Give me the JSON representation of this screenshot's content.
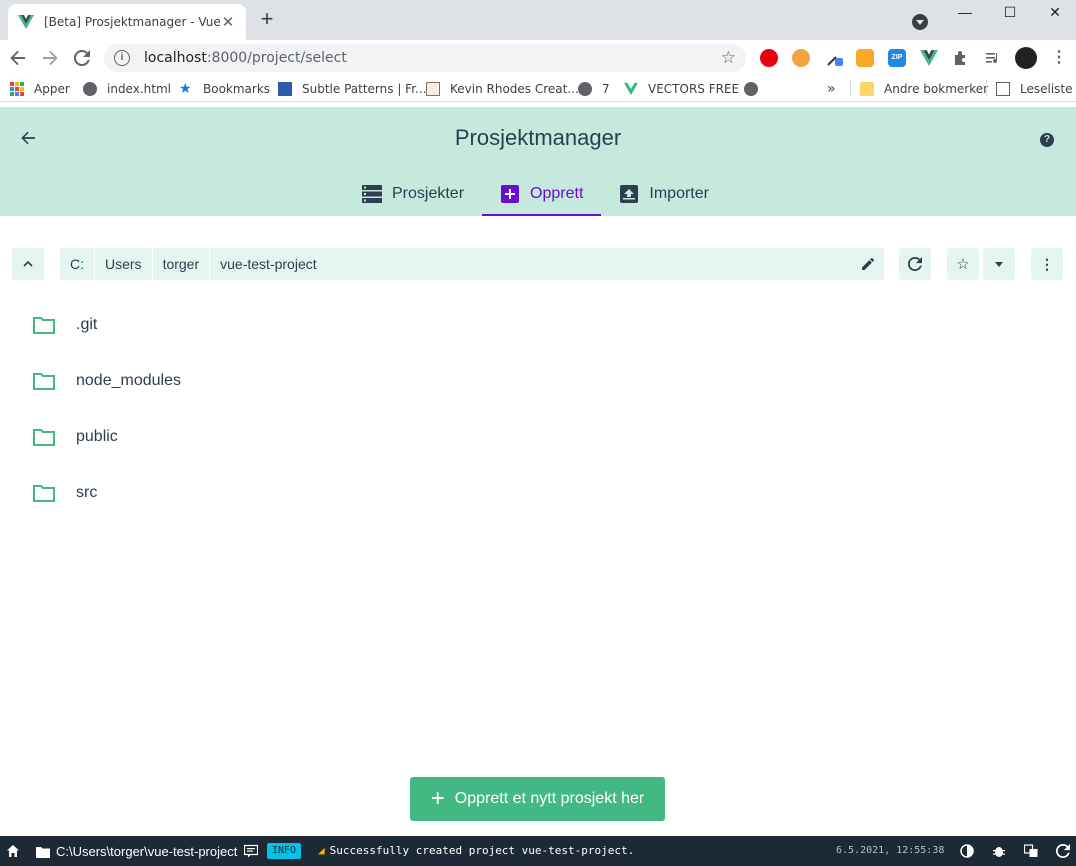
{
  "browser": {
    "tab_title": "[Beta] Prosjektmanager - Vue CLI",
    "tab_close": "✕",
    "new_tab": "+",
    "window_min": "—",
    "window_max": "☐",
    "window_close": "✕",
    "url_host": "localhost",
    "url_rest": ":8000/project/select",
    "bookmarks": [
      {
        "label": "Apper",
        "icon": "apps-grid-icon"
      },
      {
        "label": "index.html",
        "icon": "globe-icon"
      },
      {
        "label": "Bookmarks",
        "icon": "star-icon"
      },
      {
        "label": "Subtle Patterns | Fr...",
        "icon": "subtle-patterns-icon"
      },
      {
        "label": "Kevin Rhodes Creat...",
        "icon": "kr-logo-icon"
      },
      {
        "label": "7",
        "icon": "globe-icon"
      },
      {
        "label": "VECTORS FREE",
        "icon": "vectors-icon"
      },
      {
        "label": "",
        "icon": "globe-icon"
      }
    ],
    "bookmarks_overflow": "»",
    "other_bookmarks": "Andre bokmerker",
    "reading_list": "Leseliste"
  },
  "app": {
    "title": "Prosjektmanager",
    "help": "?",
    "tabs": [
      {
        "label": "Prosjekter",
        "icon": "list-icon",
        "active": false
      },
      {
        "label": "Opprett",
        "icon": "add-box-icon",
        "active": true
      },
      {
        "label": "Importer",
        "icon": "unarchive-icon",
        "active": false
      }
    ],
    "accent": "#42b983",
    "header_bg": "#c5eadd",
    "active_tab_color": "#6a0dcc"
  },
  "path": {
    "crumbs": [
      "C:",
      "Users",
      "torger",
      "vue-test-project"
    ]
  },
  "folders": [
    ".git",
    "node_modules",
    "public",
    "src"
  ],
  "create_button": {
    "label": "Opprett et nytt prosjekt her"
  },
  "status": {
    "cwd": "C:\\Users\\torger\\vue-test-project",
    "badge": "INFO",
    "message": "Successfully created project vue-test-project.",
    "timestamp": "6.5.2021, 12:55:38",
    "bg": "#1d2935"
  }
}
